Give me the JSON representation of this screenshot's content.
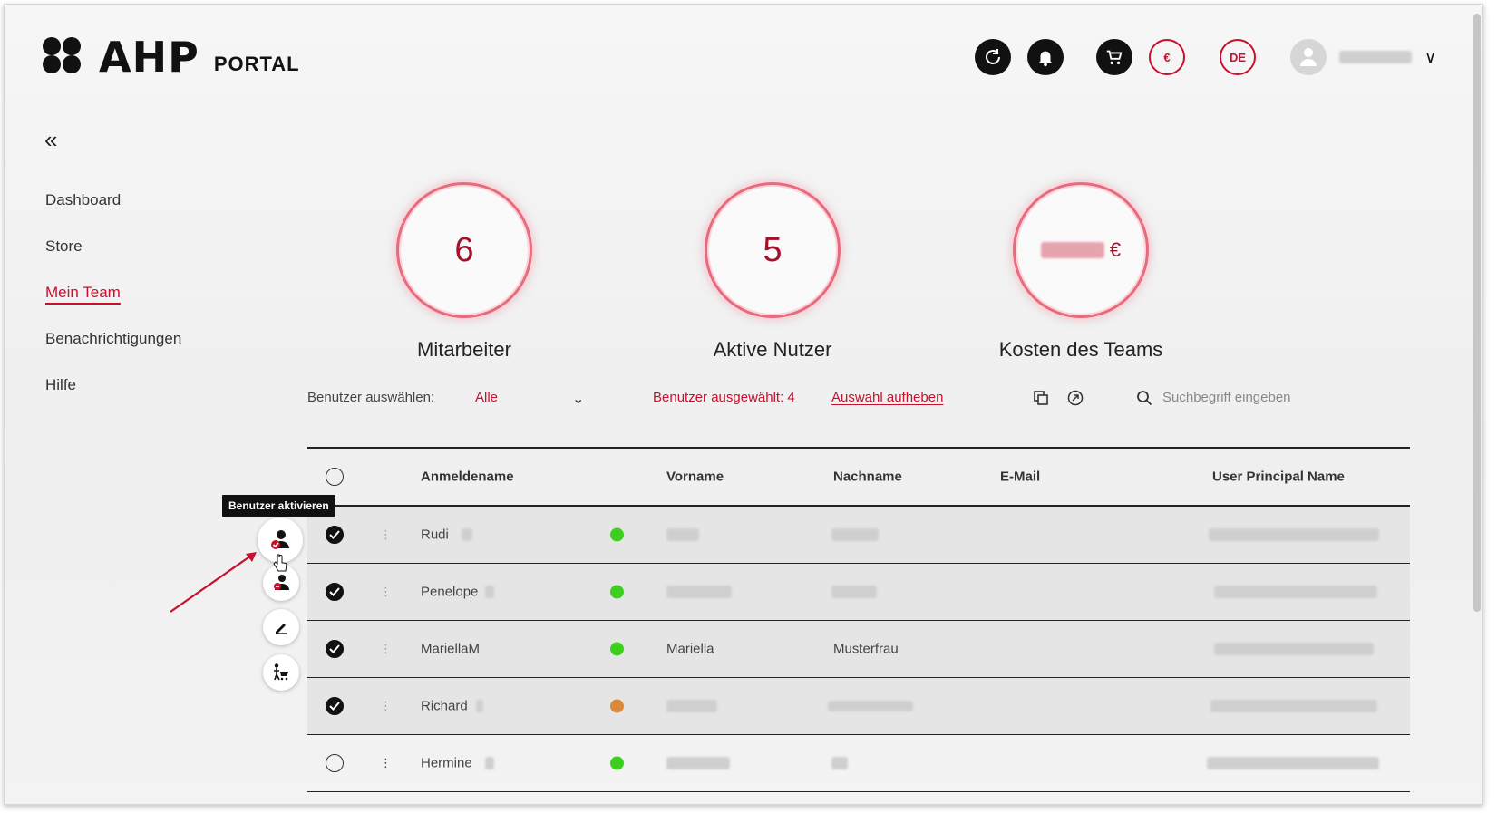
{
  "header": {
    "logo_text": "AHP",
    "logo_subtitle": "PORTAL",
    "currency_label": "€",
    "language_label": "DE",
    "user_name": ""
  },
  "sidebar": {
    "collapse_label": "«",
    "items": [
      {
        "label": "Dashboard",
        "active": false
      },
      {
        "label": "Store",
        "active": false
      },
      {
        "label": "Mein Team",
        "active": true
      },
      {
        "label": "Benachrichtigungen",
        "active": false
      },
      {
        "label": "Hilfe",
        "active": false
      }
    ]
  },
  "stats": [
    {
      "value": "6",
      "label": "Mitarbeiter"
    },
    {
      "value": "5",
      "label": "Aktive Nutzer"
    },
    {
      "value_suffix": "€",
      "label": "Kosten des Teams"
    }
  ],
  "toolbar": {
    "user_select_label": "Benutzer auswählen:",
    "user_select_value": "Alle",
    "selected_text": "Benutzer ausgewählt: 4",
    "clear_selection": "Auswahl aufheben",
    "search_placeholder": "Suchbegriff eingeben"
  },
  "table": {
    "columns": [
      "Anmeldename",
      "Vorname",
      "Nachname",
      "E-Mail",
      "User Principal Name"
    ],
    "rows": [
      {
        "checked": true,
        "login": "Rudi",
        "status_color": "#3ccf1e",
        "first_name": "",
        "last_name": ""
      },
      {
        "checked": true,
        "login": "Penelope",
        "status_color": "#3ccf1e",
        "first_name": "",
        "last_name": ""
      },
      {
        "checked": true,
        "login": "MariellaM",
        "status_color": "#3ccf1e",
        "first_name": "Mariella",
        "last_name": "Musterfrau"
      },
      {
        "checked": true,
        "login": "Richard",
        "status_color": "#d9893a",
        "first_name": "",
        "last_name": ""
      },
      {
        "checked": false,
        "login": "Hermine",
        "status_color": "#3ccf1e",
        "first_name": "",
        "last_name": ""
      }
    ]
  },
  "action_menu": {
    "tooltip": "Benutzer aktivieren",
    "actions": [
      "activate-user-icon",
      "deactivate-user-icon",
      "edit-icon",
      "assign-cart-icon"
    ]
  },
  "colors": {
    "accent": "#c8102e"
  }
}
